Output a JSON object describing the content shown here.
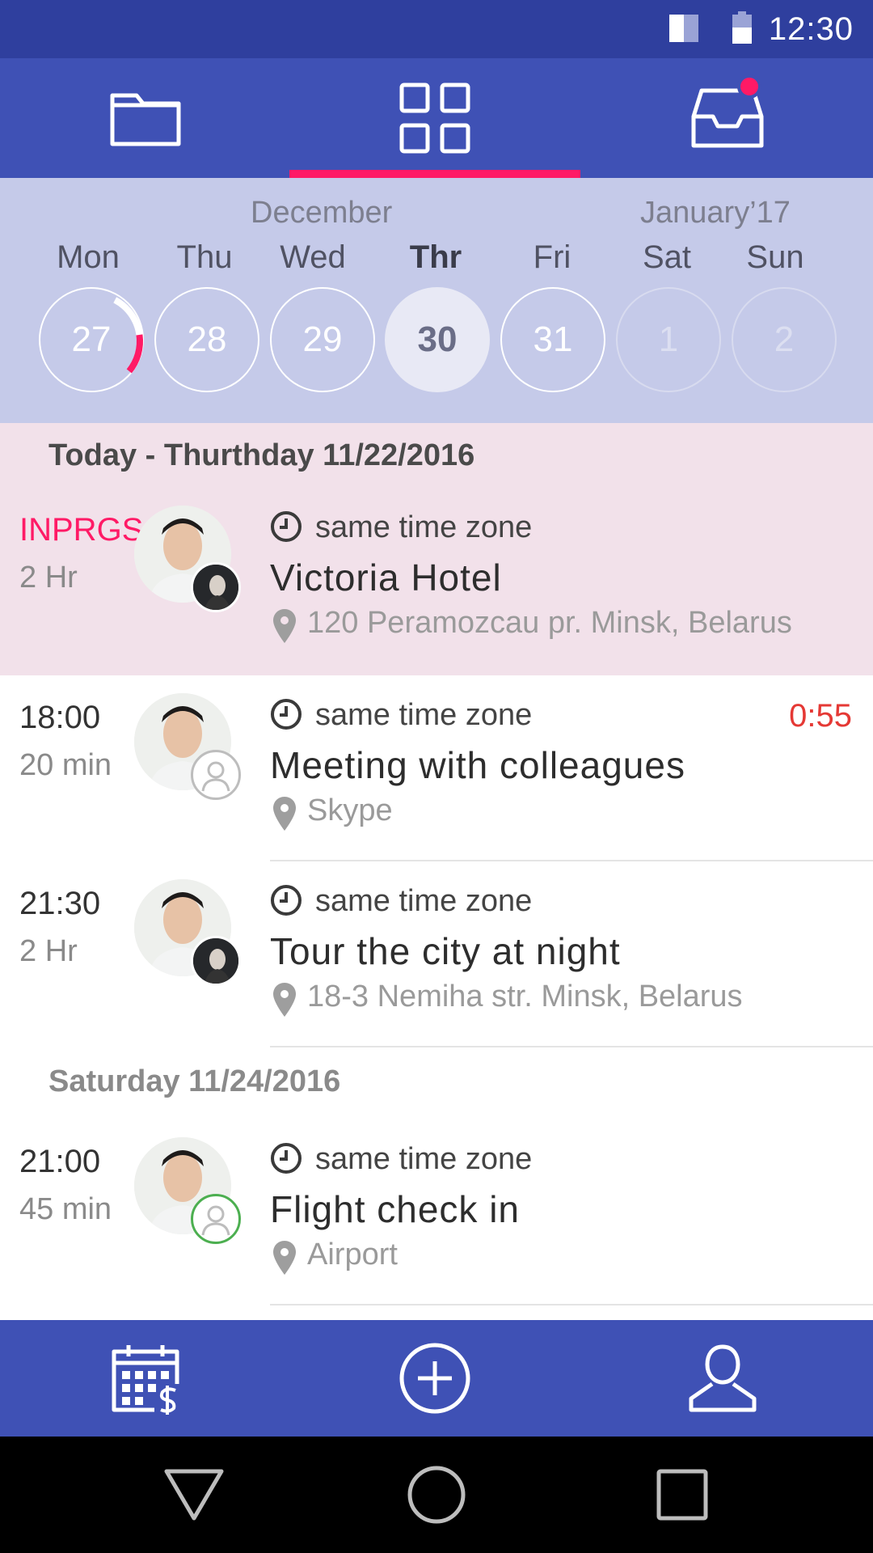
{
  "status_bar": {
    "time": "12:30"
  },
  "tabs": [
    {
      "name": "folder",
      "icon": "folder-icon"
    },
    {
      "name": "grid",
      "icon": "grid-icon",
      "active": true
    },
    {
      "name": "inbox",
      "icon": "inbox-icon",
      "has_notification": true
    }
  ],
  "calendar": {
    "months": [
      "December",
      "January’17"
    ],
    "days": [
      {
        "label": "Mon",
        "date": "27",
        "progress": 0.22
      },
      {
        "label": "Thu",
        "date": "28"
      },
      {
        "label": "Wed",
        "date": "29"
      },
      {
        "label": "Thr",
        "date": "30",
        "active": true
      },
      {
        "label": "Fri",
        "date": "31"
      },
      {
        "label": "Sat",
        "date": "1",
        "future": true
      },
      {
        "label": "Sun",
        "date": "2",
        "future": true
      }
    ]
  },
  "sections": [
    {
      "header": "Today - Thurthday 11/22/2016",
      "events": [
        {
          "time": "INPRGS",
          "duration": "2 Hr",
          "timezone": "same time zone",
          "title": "Victoria Hotel",
          "location": "120 Peramozcau pr. Minsk, Belarus",
          "status": "in-progress"
        },
        {
          "time": "18:00",
          "duration": "20 min",
          "timezone": "same time zone",
          "title": "Meeting with colleagues",
          "location": "Skype",
          "countdown": "0:55"
        },
        {
          "time": "21:30",
          "duration": "2 Hr",
          "timezone": "same time zone",
          "title": "Tour the city at night",
          "location": "18-3 Nemiha str. Minsk, Belarus"
        }
      ]
    },
    {
      "header": "Saturday 11/24/2016",
      "events": [
        {
          "time": "21:00",
          "duration": "45 min",
          "timezone": "same time zone",
          "title": "Flight check in",
          "location": "Airport"
        }
      ]
    }
  ],
  "bottom_nav": [
    {
      "name": "calendar-pricing",
      "icon": "calendar-dollar-icon"
    },
    {
      "name": "add",
      "icon": "add-circle-icon"
    },
    {
      "name": "profile",
      "icon": "user-icon"
    }
  ],
  "colors": {
    "primary": "#3f51b5",
    "primary_dark": "#2f3f9e",
    "accent": "#ff1a66",
    "calendar_bg": "#c5cae9",
    "inprogress_bg": "#f2e1ea",
    "countdown": "#e53935"
  }
}
